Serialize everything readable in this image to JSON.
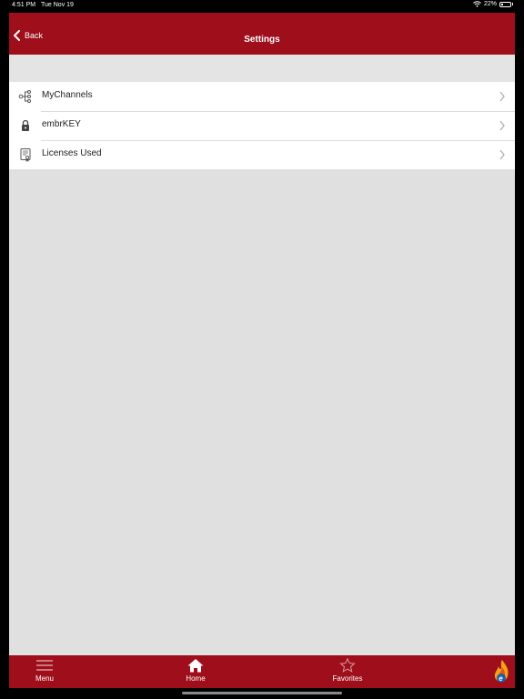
{
  "status_bar": {
    "time": "4:51 PM",
    "date": "Tue Nov 19",
    "battery": "22%"
  },
  "header": {
    "back_label": "Back",
    "title": "Settings"
  },
  "settings": {
    "items": [
      {
        "label": "MyChannels",
        "icon": "channels-icon"
      },
      {
        "label": "embrKEY",
        "icon": "lock-icon"
      },
      {
        "label": "Licenses Used",
        "icon": "certificate-icon"
      }
    ]
  },
  "tab_bar": {
    "menu_label": "Menu",
    "home_label": "Home",
    "favorites_label": "Favorites"
  },
  "colors": {
    "brand_red": "#9e0e1b",
    "background": "#e0e0e0",
    "list_background": "#ffffff"
  }
}
